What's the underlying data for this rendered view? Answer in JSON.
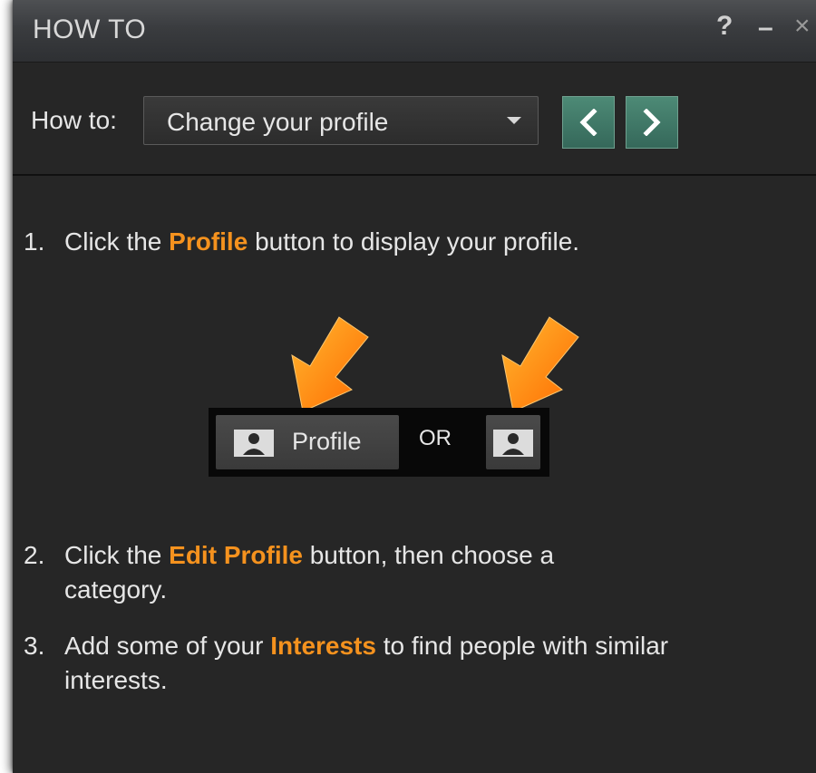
{
  "window": {
    "title": "HOW TO",
    "help_label": "?",
    "minimize_label": "–",
    "close_label": "×"
  },
  "toolbar": {
    "howto_label": "How to:",
    "dropdown_value": "Change your profile"
  },
  "steps": [
    {
      "num": "1.",
      "before": "Click the ",
      "highlight": "Profile",
      "after": " button to display your profile."
    },
    {
      "num": "2.",
      "before": "Click the ",
      "highlight": "Edit Profile",
      "after": " button, then choose a category."
    },
    {
      "num": "3.",
      "before": "Add some of your ",
      "highlight": "Interests",
      "after": " to find people with similar interests."
    }
  ],
  "illustration": {
    "profile_label": "Profile",
    "or_label": "OR"
  },
  "colors": {
    "highlight": "#f5921e",
    "nav_button": "#3f7a68",
    "background": "#262626"
  },
  "icons": [
    "help-icon",
    "minimize-icon",
    "close-icon",
    "dropdown-caret-icon",
    "chevron-left-icon",
    "chevron-right-icon",
    "person-icon",
    "arrow-icon"
  ]
}
